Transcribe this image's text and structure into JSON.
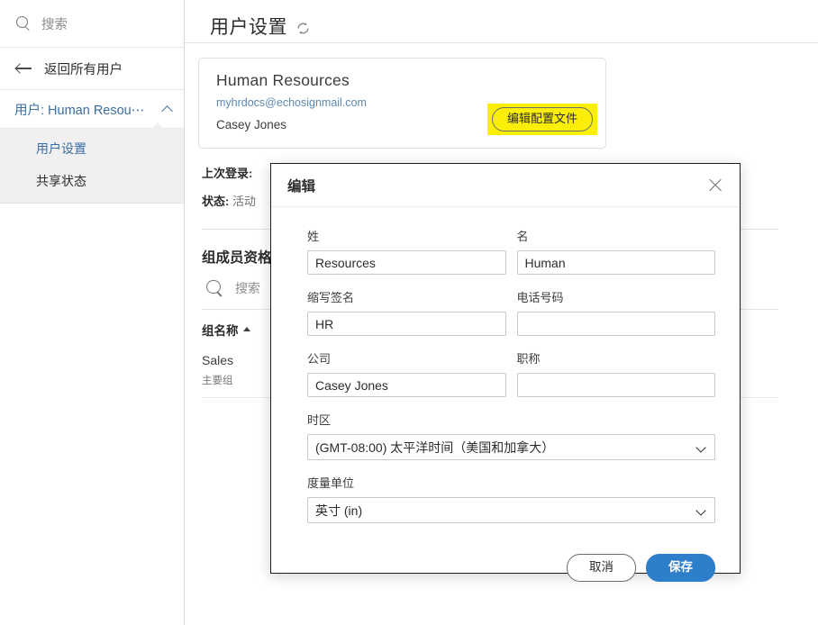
{
  "sidebar": {
    "search": {
      "placeholder": "搜索",
      "icon": "search-icon"
    },
    "back": {
      "label": "返回所有用户",
      "icon": "arrow-left-icon"
    },
    "user_node": {
      "label": "用户: Human Resou⋯",
      "icon": "chevron-up-icon"
    },
    "sub_items": [
      {
        "label": "用户设置",
        "active": true
      },
      {
        "label": "共享状态",
        "active": false
      }
    ]
  },
  "main": {
    "title": "用户设置",
    "refresh_icon": "refresh-icon",
    "card": {
      "name": "Human Resources",
      "email": "myhrdocs@echosignmail.com",
      "contact": "Casey Jones",
      "edit_button": "编辑配置文件",
      "highlight_color": "#fbee09"
    },
    "meta": [
      {
        "label": "上次登录:",
        "value": ""
      },
      {
        "label": "状态:",
        "value": "活动"
      }
    ],
    "group_section": {
      "title": "组成员资格",
      "search_placeholder": "搜索",
      "column_header": "组名称",
      "sort_direction": "asc",
      "rows": [
        {
          "name": "Sales",
          "note": "主要组"
        }
      ]
    }
  },
  "modal": {
    "title": "编辑",
    "close_icon": "close-icon",
    "fields": [
      {
        "label": "姓",
        "value": "Resources",
        "placeholder": ""
      },
      {
        "label": "名",
        "value": "Human",
        "placeholder": ""
      },
      {
        "label": "缩写签名",
        "value": "HR",
        "placeholder": ""
      },
      {
        "label": "电话号码",
        "value": "",
        "placeholder": ""
      },
      {
        "label": "公司",
        "value": "Casey Jones",
        "placeholder": ""
      },
      {
        "label": "职称",
        "value": "",
        "placeholder": ""
      }
    ],
    "timezone": {
      "label": "时区",
      "value": "(GMT-08:00) 太平洋时间（美国和加拿大）"
    },
    "units": {
      "label": "度量单位",
      "value": "英寸 (in)"
    },
    "cancel_label": "取消",
    "save_label": "保存",
    "save_color": "#2d7ecb"
  }
}
